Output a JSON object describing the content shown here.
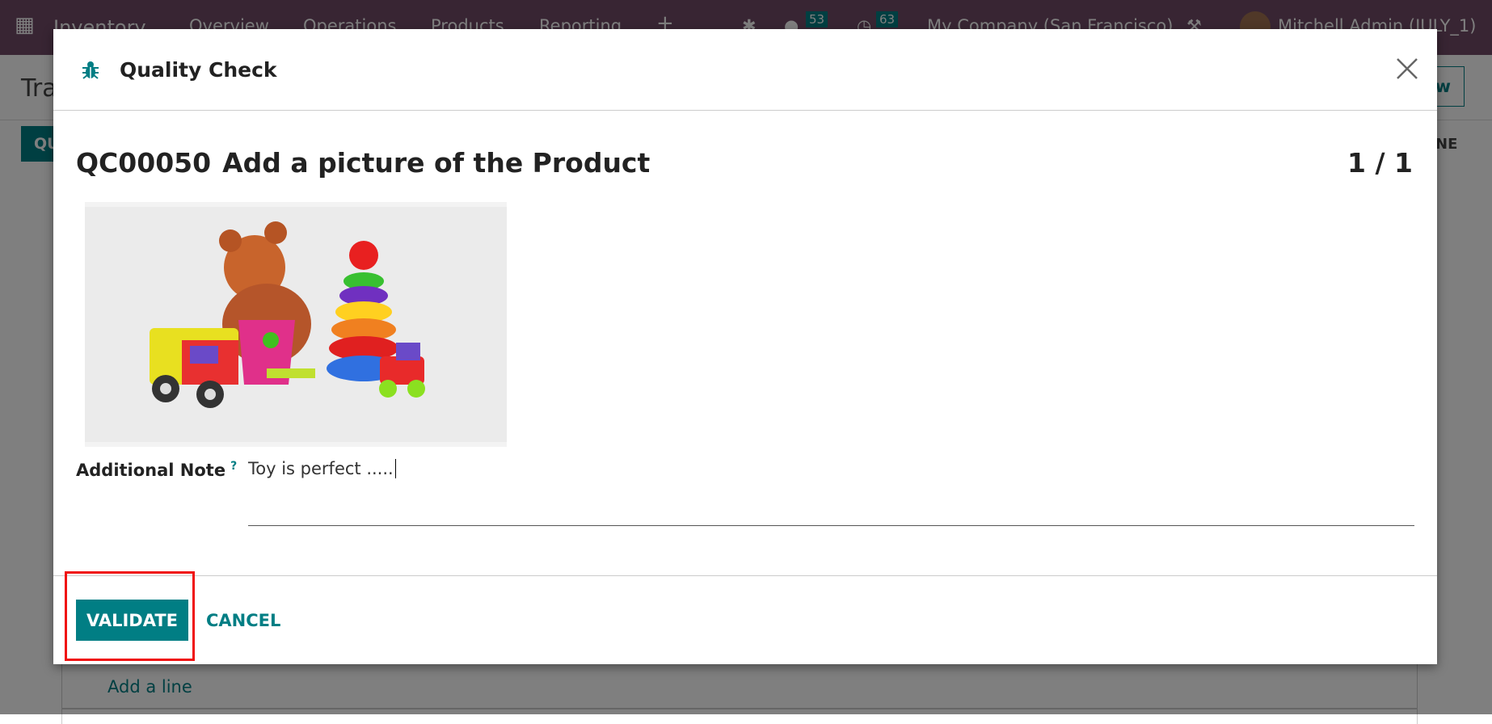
{
  "navbar": {
    "app": "Inventory",
    "menu": [
      "Overview",
      "Operations",
      "Products",
      "Reporting"
    ],
    "messages_count": "53",
    "activities_count": "63",
    "company": "My Company (San Francisco)",
    "user": "Mitchell Admin (JULY_1)"
  },
  "background": {
    "breadcrumb": "Tra",
    "new_button": "New",
    "quality_button": "QU",
    "column_partial": "NE",
    "add_line": "Add a line"
  },
  "dialog": {
    "title": "Quality Check",
    "reference": "QC00050",
    "check_title": "Add a picture of the Product",
    "counter": "1 / 1",
    "note_label": "Additional Note",
    "note_help": "?",
    "note_value": "Toy is perfect .....",
    "validate_label": "VALIDATE",
    "cancel_label": "CANCEL"
  },
  "colors": {
    "brand": "#714B67",
    "accent": "#017e84",
    "highlight": "#f01010"
  }
}
